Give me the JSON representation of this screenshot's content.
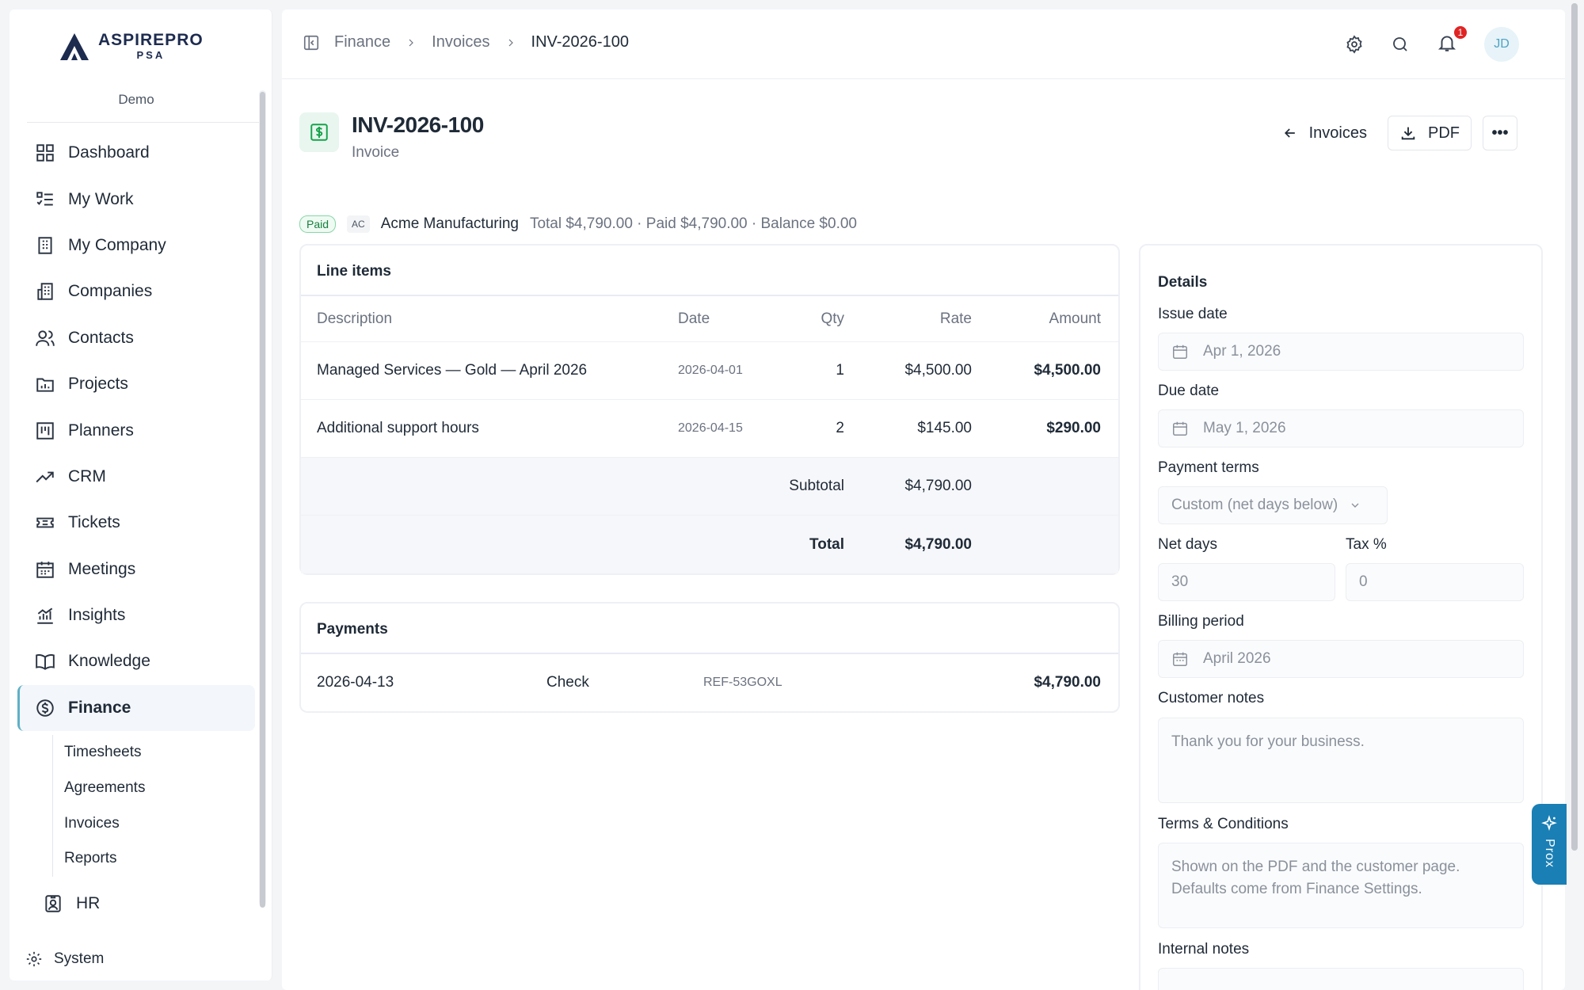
{
  "brand": {
    "name": "ASPIREPRO",
    "sub": "PSA",
    "workspace": "Demo"
  },
  "sidebar": {
    "items": [
      {
        "label": "Dashboard",
        "icon": "grid-icon"
      },
      {
        "label": "My Work",
        "icon": "list-check-icon"
      },
      {
        "label": "My Company",
        "icon": "building-icon"
      },
      {
        "label": "Companies",
        "icon": "buildings-icon"
      },
      {
        "label": "Contacts",
        "icon": "users-icon"
      },
      {
        "label": "Projects",
        "icon": "folder-chart-icon"
      },
      {
        "label": "Planners",
        "icon": "kanban-icon"
      },
      {
        "label": "CRM",
        "icon": "trend-icon"
      },
      {
        "label": "Tickets",
        "icon": "ticket-icon"
      },
      {
        "label": "Meetings",
        "icon": "calendar-icon"
      },
      {
        "label": "Insights",
        "icon": "bar-chart-icon"
      },
      {
        "label": "Knowledge",
        "icon": "book-icon"
      },
      {
        "label": "Finance",
        "icon": "dollar-circle-icon",
        "active": true
      }
    ],
    "finance_sub": [
      "Timesheets",
      "Agreements",
      "Invoices",
      "Reports"
    ],
    "hr": "HR",
    "system": "System"
  },
  "breadcrumb": [
    "Finance",
    "Invoices",
    "INV-2026-100"
  ],
  "notifications_count": "1",
  "user_initials": "JD",
  "invoice": {
    "number": "INV-2026-100",
    "type": "Invoice",
    "back_label": "Invoices",
    "pdf_label": "PDF",
    "more_label": "•••",
    "status": "Paid",
    "customer_initials": "AC",
    "customer": "Acme Manufacturing",
    "totals_line": "Total $4,790.00 · Paid $4,790.00 · Balance $0.00"
  },
  "line_items": {
    "title": "Line items",
    "headers": {
      "description": "Description",
      "date": "Date",
      "qty": "Qty",
      "rate": "Rate",
      "amount": "Amount"
    },
    "rows": [
      {
        "description": "Managed Services — Gold — April 2026",
        "date": "2026-04-01",
        "qty": "1",
        "rate": "$4,500.00",
        "amount": "$4,500.00"
      },
      {
        "description": "Additional support hours",
        "date": "2026-04-15",
        "qty": "2",
        "rate": "$145.00",
        "amount": "$290.00"
      }
    ],
    "subtotal_label": "Subtotal",
    "subtotal": "$4,790.00",
    "total_label": "Total",
    "total": "$4,790.00"
  },
  "payments": {
    "title": "Payments",
    "rows": [
      {
        "date": "2026-04-13",
        "method": "Check",
        "reference": "REF-53GOXL",
        "amount": "$4,790.00"
      }
    ]
  },
  "details": {
    "title": "Details",
    "issue_date_label": "Issue date",
    "issue_date": "Apr 1, 2026",
    "due_date_label": "Due date",
    "due_date": "May 1, 2026",
    "payment_terms_label": "Payment terms",
    "payment_terms": "Custom (net days below)",
    "net_days_label": "Net days",
    "net_days": "30",
    "tax_label": "Tax %",
    "tax": "0",
    "billing_period_label": "Billing period",
    "billing_period": "April 2026",
    "customer_notes_label": "Customer notes",
    "customer_notes_placeholder": "Thank you for your business.",
    "terms_label": "Terms & Conditions",
    "terms_placeholder": "Shown on the PDF and the customer page. Defaults come from Finance Settings.",
    "internal_notes_label": "Internal notes"
  },
  "assistant": {
    "label": "Prox"
  }
}
